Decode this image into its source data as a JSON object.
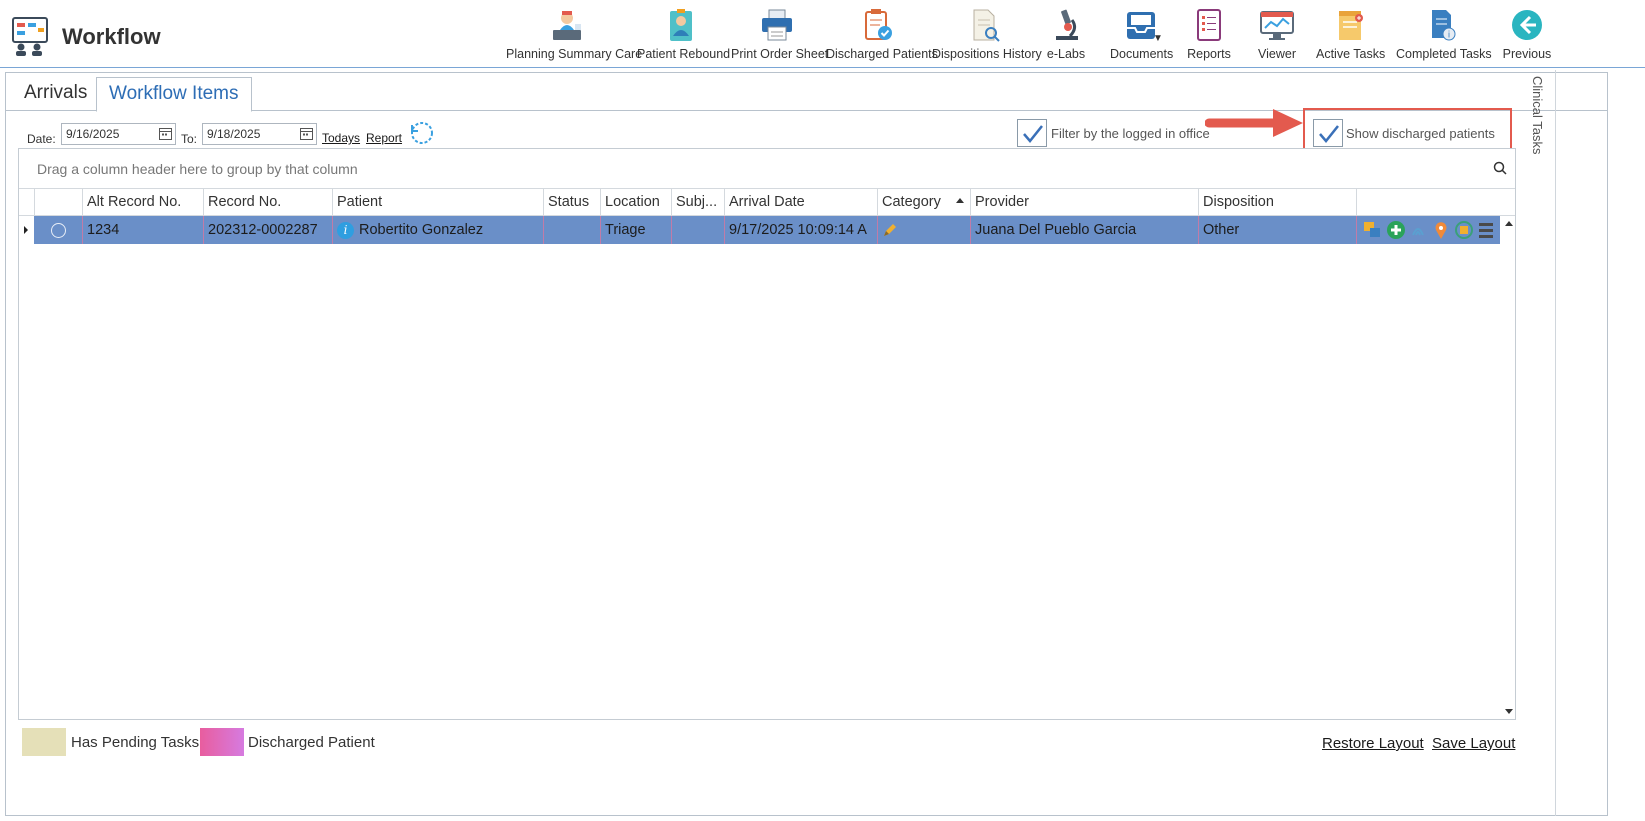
{
  "app": {
    "title": "Workflow"
  },
  "toolbar": {
    "items": [
      {
        "label": "Planning Summary Care",
        "icon": "doctor-desk-icon"
      },
      {
        "label": "Patient Rebound",
        "icon": "patient-badge-icon"
      },
      {
        "label": "Print Order Sheet",
        "icon": "printer-icon"
      },
      {
        "label": "Discharged Patients",
        "icon": "clipboard-check-icon"
      },
      {
        "label": "Dispositions History",
        "icon": "document-search-icon"
      },
      {
        "label": "e-Labs",
        "icon": "microscope-icon"
      },
      {
        "label": "Documents",
        "icon": "inbox-tray-icon"
      },
      {
        "label": "Reports",
        "icon": "report-list-icon"
      },
      {
        "label": "Viewer",
        "icon": "monitor-icon"
      },
      {
        "label": "Active Tasks",
        "icon": "task-note-icon"
      },
      {
        "label": "Completed Tasks",
        "icon": "completed-document-icon"
      },
      {
        "label": "Previous",
        "icon": "back-arrow-icon"
      }
    ]
  },
  "tabs": [
    {
      "label": "Arrivals",
      "active": false
    },
    {
      "label": "Workflow Items",
      "active": true
    }
  ],
  "filters": {
    "date_label": "Date:",
    "date_from": "9/16/2025",
    "to_label": "To:",
    "date_to": "9/18/2025",
    "todays_link": "Todays",
    "report_link": "Report",
    "filter_office_label": "Filter by the logged in office",
    "filter_office_checked": true,
    "show_discharged_label": "Show discharged patients",
    "show_discharged_checked": true
  },
  "grid": {
    "group_panel_text": "Drag a column header here to group by that column",
    "columns": [
      "",
      "Alt Record No.",
      "Record No.",
      "Patient",
      "Status",
      "Location",
      "Subj...",
      "Arrival Date",
      "Category",
      "Provider",
      "Disposition",
      ""
    ],
    "sorted_column": "Category",
    "rows": [
      {
        "alt_record_no": "1234",
        "record_no": "202312-0002287",
        "patient": "Robertito Gonzalez",
        "status": "",
        "location": "Triage",
        "subject": "",
        "arrival_date": "9/17/2025 10:09:14 A",
        "category": "",
        "provider": "Juana Del Pueblo Garcia",
        "disposition": "Other",
        "selected": true
      }
    ],
    "row_action_icons": [
      "transfer-icon",
      "add-icon",
      "wave-icon",
      "location-pin-icon",
      "history-icon",
      "menu-icon"
    ]
  },
  "legend": [
    {
      "label": "Has Pending Tasks",
      "color": "#e5e0b8"
    },
    {
      "label": "Discharged Patient",
      "color": "#e85d9e"
    }
  ],
  "footer": {
    "restore_layout": "Restore Layout",
    "save_layout": "Save Layout"
  },
  "side_panel": {
    "label": "Clinical Tasks"
  },
  "colors": {
    "accent": "#2d6db5",
    "selected_row": "#6a8fc8",
    "annotation": "#e35a4e"
  }
}
